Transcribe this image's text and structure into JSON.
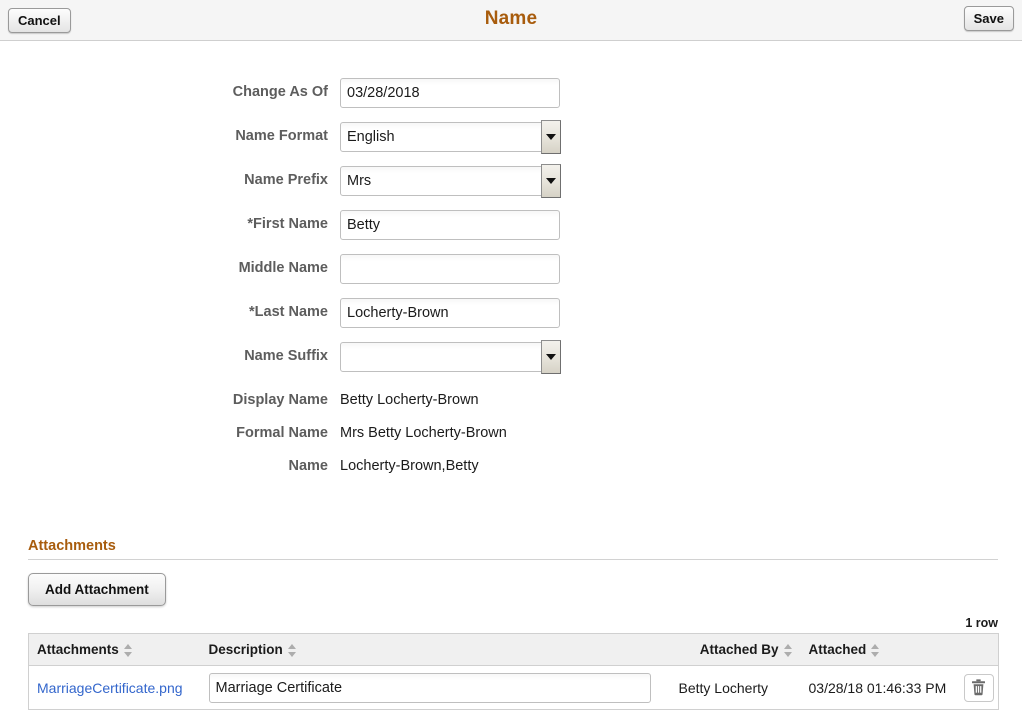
{
  "header": {
    "title": "Name",
    "cancel_label": "Cancel",
    "save_label": "Save"
  },
  "form": {
    "fields": [
      {
        "label": "Change As Of",
        "value": "03/28/2018",
        "type": "text"
      },
      {
        "label": "Name Format",
        "value": "English",
        "type": "select"
      },
      {
        "label": "Name Prefix",
        "value": "Mrs",
        "type": "select"
      },
      {
        "label": "*First Name",
        "value": "Betty",
        "type": "text"
      },
      {
        "label": "Middle Name",
        "value": "",
        "type": "text"
      },
      {
        "label": "*Last Name",
        "value": "Locherty-Brown",
        "type": "text"
      },
      {
        "label": "Name Suffix",
        "value": "",
        "type": "select"
      },
      {
        "label": "Display Name",
        "value": "Betty Locherty-Brown",
        "type": "static"
      },
      {
        "label": "Formal Name",
        "value": "Mrs Betty Locherty-Brown",
        "type": "static"
      },
      {
        "label": "Name",
        "value": "Locherty-Brown,Betty",
        "type": "static"
      }
    ]
  },
  "attachments": {
    "section_title": "Attachments",
    "add_button_label": "Add Attachment",
    "row_count_label": "1 row",
    "columns": [
      {
        "label": "Attachments"
      },
      {
        "label": "Description"
      },
      {
        "label": "Attached By"
      },
      {
        "label": "Attached"
      },
      {
        "label": ""
      }
    ],
    "rows": [
      {
        "file_name": "MarriageCertificate.png",
        "description": "Marriage Certificate",
        "attached_by": "Betty Locherty",
        "attached_on": "03/28/18 01:46:33 PM",
        "delete_icon": "trash-icon"
      }
    ]
  },
  "colors": {
    "accent_brown": "#a85c0d",
    "link_blue": "#3366cc",
    "label_gray": "#5d5d5d",
    "header_bg": "#f5f5f5",
    "grid_header_bg": "#f0f0f0"
  }
}
